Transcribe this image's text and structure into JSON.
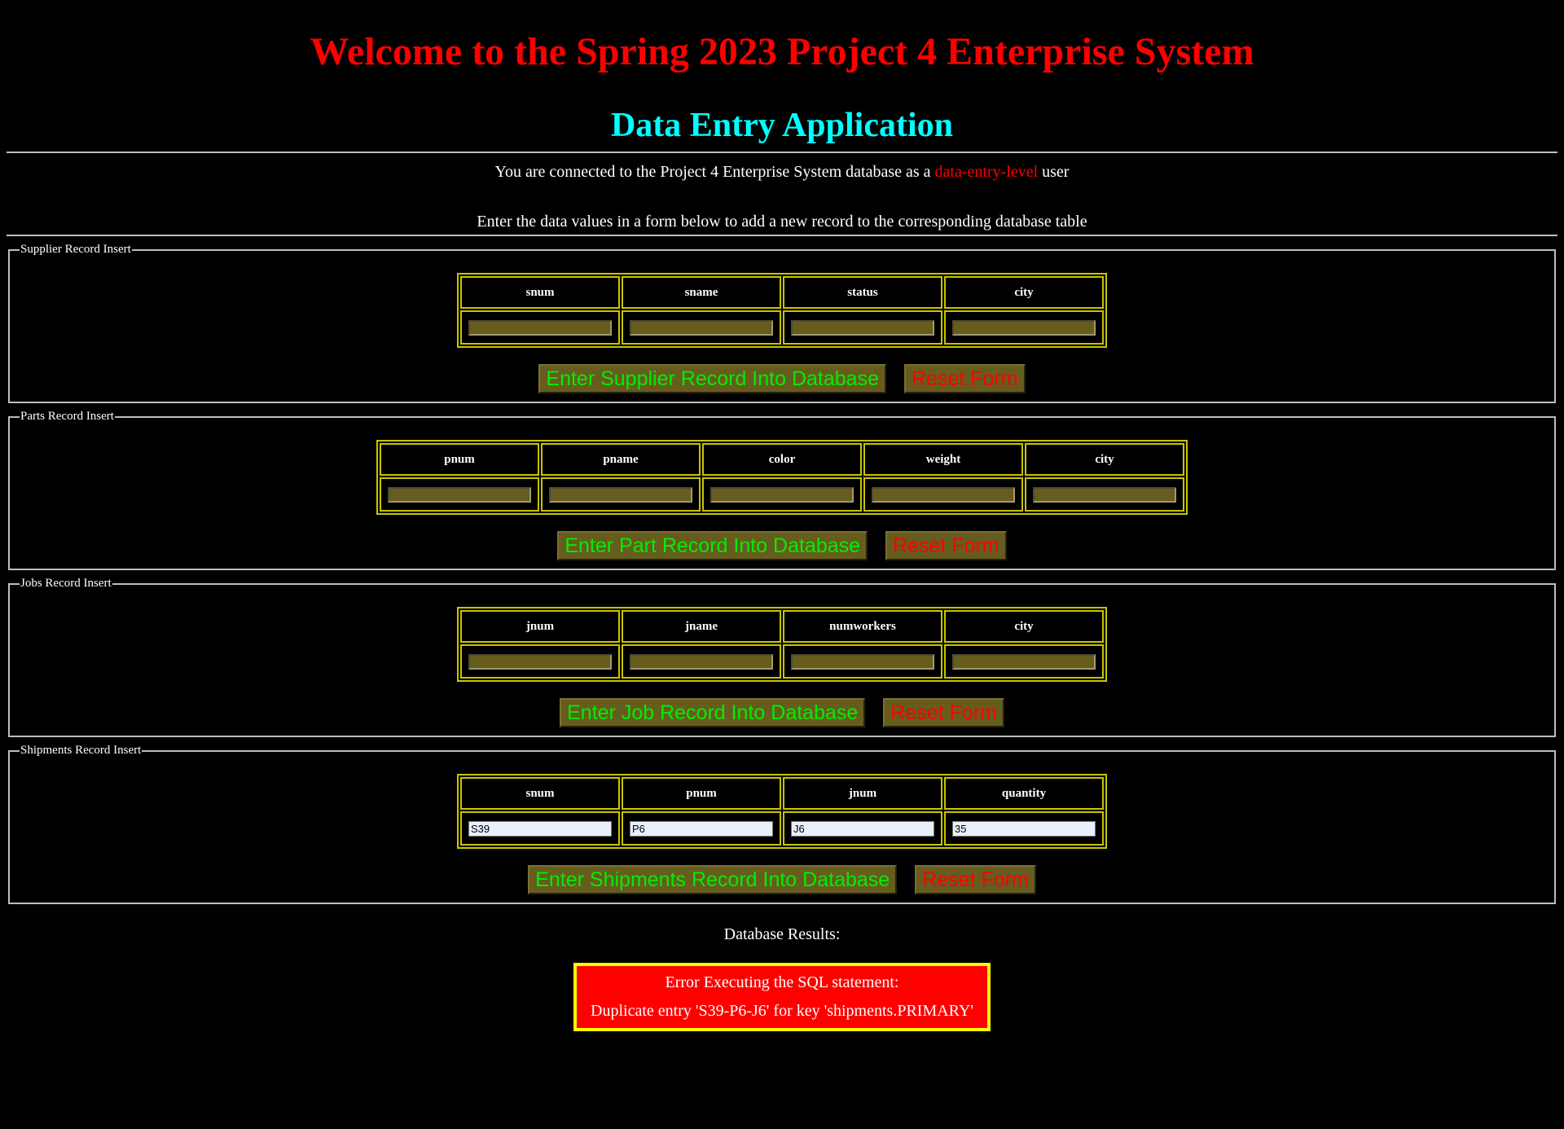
{
  "header": {
    "title": "Welcome to the Spring 2023 Project 4 Enterprise System",
    "subtitle": "Data Entry Application"
  },
  "info": {
    "connected_prefix": "You are connected to the Project 4 Enterprise System database as a",
    "role": "data-entry-level",
    "connected_suffix": "user",
    "instructions": "Enter the data values in a form below to add a new record to the corresponding database table"
  },
  "supplier": {
    "legend": "Supplier Record Insert",
    "columns": [
      "snum",
      "sname",
      "status",
      "city"
    ],
    "values": [
      "",
      "",
      "",
      ""
    ],
    "submit_label": "Enter Supplier Record Into Database",
    "reset_label": "Reset Form"
  },
  "parts": {
    "legend": "Parts Record Insert",
    "columns": [
      "pnum",
      "pname",
      "color",
      "weight",
      "city"
    ],
    "values": [
      "",
      "",
      "",
      "",
      ""
    ],
    "submit_label": "Enter Part Record Into Database",
    "reset_label": "Reset Form"
  },
  "jobs": {
    "legend": "Jobs Record Insert",
    "columns": [
      "jnum",
      "jname",
      "numworkers",
      "city"
    ],
    "values": [
      "",
      "",
      "",
      ""
    ],
    "submit_label": "Enter Job Record Into Database",
    "reset_label": "Reset Form"
  },
  "shipments": {
    "legend": "Shipments Record Insert",
    "columns": [
      "snum",
      "pnum",
      "jnum",
      "quantity"
    ],
    "values": [
      "S39",
      "P6",
      "J6",
      "35"
    ],
    "submit_label": "Enter Shipments Record Into Database",
    "reset_label": "Reset Form"
  },
  "results": {
    "label": "Database Results:",
    "error_line1": "Error Executing the SQL statement:",
    "error_line2": "Duplicate entry 'S39-P6-J6' for key 'shipments.PRIMARY'"
  },
  "colors": {
    "background": "#000000",
    "title": "#ff0000",
    "subtitle": "#00ffff",
    "table_border": "#c9c400",
    "input_bg": "#665c1e",
    "submit_text": "#00ee00",
    "reset_text": "#ff0000",
    "error_bg": "#ff0000",
    "error_border": "#ffff00"
  }
}
